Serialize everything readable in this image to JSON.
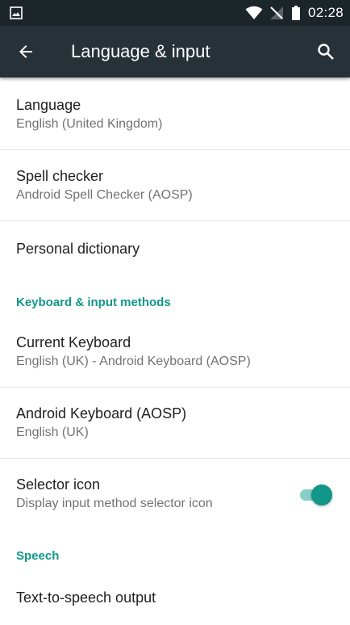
{
  "status_bar": {
    "time": "02:28",
    "icons": [
      "gallery-icon",
      "wifi-icon",
      "no-signal-icon",
      "battery-icon"
    ]
  },
  "app_bar": {
    "title": "Language & input",
    "icons": [
      "back-arrow-icon",
      "search-icon"
    ]
  },
  "items": {
    "language": {
      "title": "Language",
      "summary": "English (United Kingdom)"
    },
    "spell_checker": {
      "title": "Spell checker",
      "summary": "Android Spell Checker (AOSP)"
    },
    "personal_dictionary": {
      "title": "Personal dictionary"
    },
    "keyboard_section": {
      "header": "Keyboard & input methods"
    },
    "current_keyboard": {
      "title": "Current Keyboard",
      "summary": "English (UK) - Android Keyboard (AOSP)"
    },
    "android_keyboard": {
      "title": "Android Keyboard (AOSP)",
      "summary": "English (UK)"
    },
    "selector_icon": {
      "title": "Selector icon",
      "summary": "Display input method selector icon",
      "enabled": true
    },
    "speech_section": {
      "header": "Speech"
    },
    "tts": {
      "title": "Text-to-speech output"
    }
  },
  "colors": {
    "status_bar": "#1c2529",
    "app_bar": "#263238",
    "accent": "#129689",
    "accent_light": "#89cdc6"
  }
}
